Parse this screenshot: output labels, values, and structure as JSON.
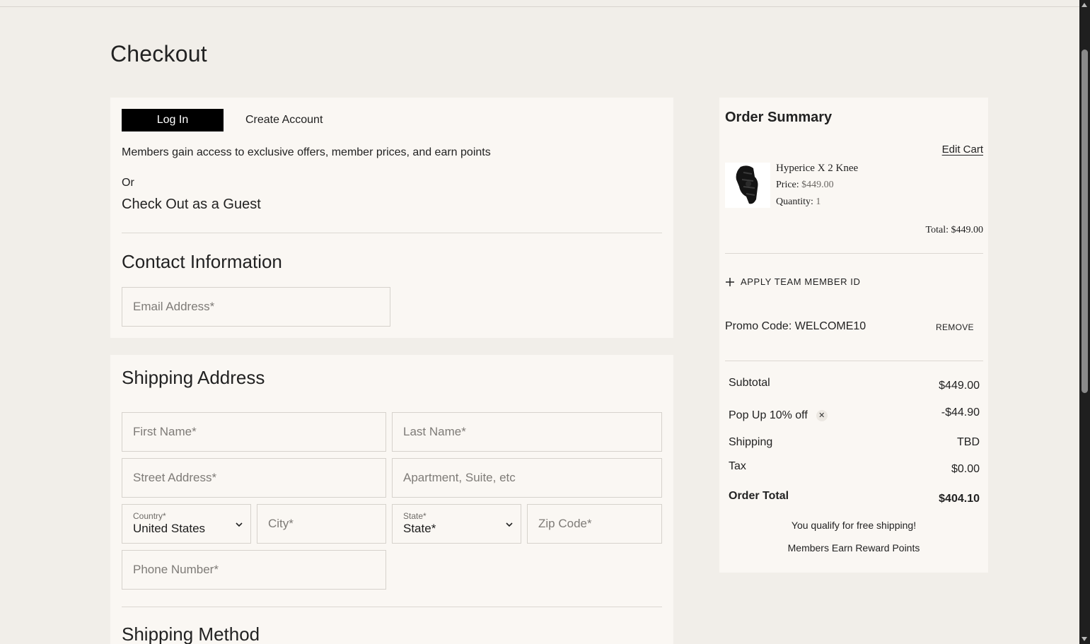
{
  "page": {
    "title": "Checkout"
  },
  "auth": {
    "login_label": "Log In",
    "create_label": "Create Account",
    "members_text": "Members gain access to exclusive offers, member prices, and earn points",
    "or_text": "Or",
    "guest_text": "Check Out as a Guest"
  },
  "contact": {
    "title": "Contact Information",
    "email_placeholder": "Email Address*"
  },
  "shipping": {
    "title": "Shipping Address",
    "first_name_placeholder": "First Name*",
    "last_name_placeholder": "Last Name*",
    "street_placeholder": "Street Address*",
    "apt_placeholder": "Apartment, Suite, etc",
    "country_label": "Country*",
    "country_value": "United States",
    "city_placeholder": "City*",
    "state_label": "State*",
    "state_value": "State*",
    "zip_placeholder": "Zip Code*",
    "phone_placeholder": "Phone Number*",
    "method_title": "Shipping Method"
  },
  "summary": {
    "title": "Order Summary",
    "edit_cart": "Edit Cart",
    "item": {
      "name": "Hyperice X 2 Knee",
      "price_label": "Price:",
      "price_value": "$449.00",
      "qty_label": "Quantity:",
      "qty_value": "1",
      "total": "Total: $449.00"
    },
    "apply_team": "APPLY TEAM MEMBER ID",
    "promo_label": "Promo Code: WELCOME10",
    "promo_remove": "REMOVE",
    "subtotal_label": "Subtotal",
    "subtotal_value": "$449.00",
    "discount_label": "Pop Up 10% off",
    "discount_value": "-$44.90",
    "shipping_label": "Shipping",
    "shipping_value": "TBD",
    "tax_label": "Tax",
    "tax_value": "$0.00",
    "order_total_label": "Order Total",
    "order_total_value": "$404.10",
    "free_shipping_note": "You qualify for free shipping!",
    "reward_note": "Members Earn Reward Points"
  }
}
